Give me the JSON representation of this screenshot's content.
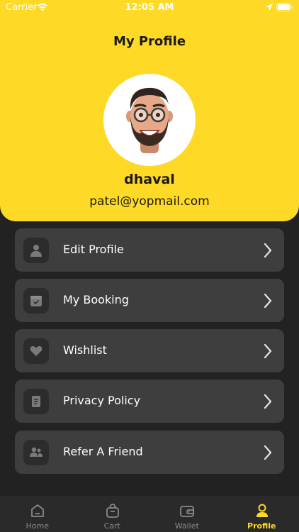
{
  "status_bar": {
    "carrier": "Carrier",
    "time": "12:05 AM"
  },
  "header": {
    "title": "My Profile"
  },
  "profile": {
    "name": "dhaval",
    "email": "patel@yopmail.com"
  },
  "menu": [
    {
      "label": "Edit Profile",
      "icon": "user-icon"
    },
    {
      "label": "My Booking",
      "icon": "calendar-icon"
    },
    {
      "label": "Wishlist",
      "icon": "heart-icon"
    },
    {
      "label": "Privacy Policy",
      "icon": "document-icon"
    },
    {
      "label": "Refer A Friend",
      "icon": "users-icon"
    }
  ],
  "tabs": [
    {
      "label": "Home",
      "icon": "home-icon",
      "active": false
    },
    {
      "label": "Cart",
      "icon": "bag-icon",
      "active": false
    },
    {
      "label": "Wallet",
      "icon": "wallet-icon",
      "active": false
    },
    {
      "label": "Profile",
      "icon": "profile-icon",
      "active": true
    }
  ],
  "colors": {
    "accent": "#FED926",
    "background": "#222222",
    "card": "#3e3e3e"
  }
}
